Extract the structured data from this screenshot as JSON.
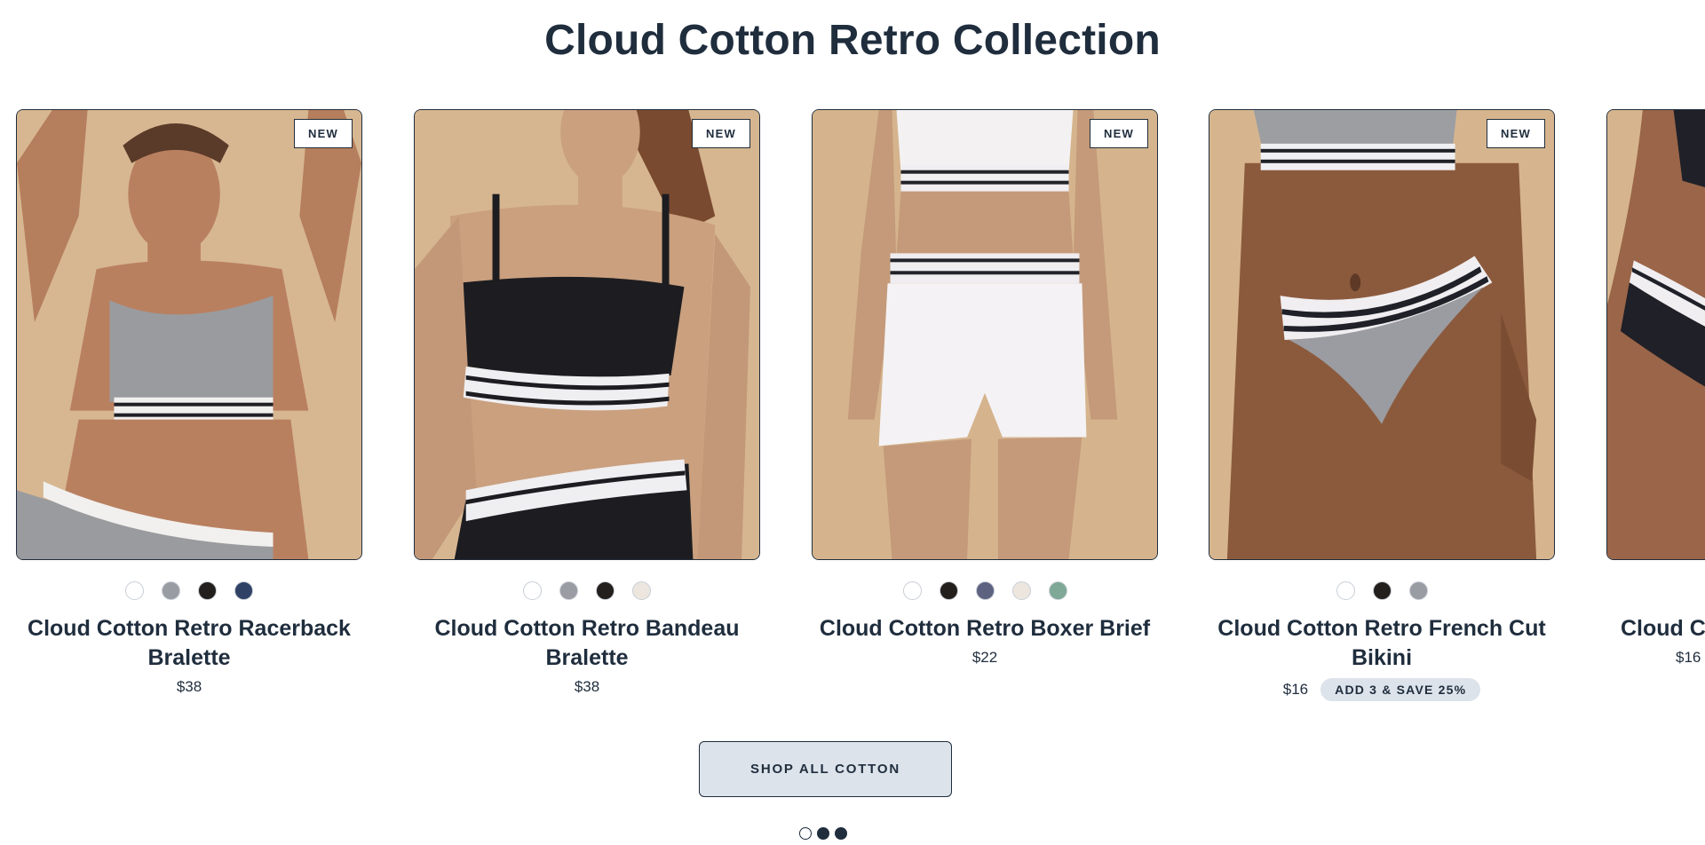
{
  "section": {
    "title": "Cloud Cotton Retro Collection"
  },
  "products": [
    {
      "badge": "NEW",
      "name": "Cloud Cotton Retro Racerback Bralette",
      "price": "$38",
      "swatches": [
        "#ffffff",
        "#9a9ca3",
        "#231f1c",
        "#2f4266"
      ]
    },
    {
      "badge": "NEW",
      "name": "Cloud Cotton Retro Bandeau Bralette",
      "price": "$38",
      "swatches": [
        "#ffffff",
        "#9a9ca3",
        "#231f1c",
        "#ece6df"
      ]
    },
    {
      "badge": "NEW",
      "name": "Cloud Cotton Retro Boxer Brief",
      "price": "$22",
      "swatches": [
        "#ffffff",
        "#231f1c",
        "#5d6280",
        "#ece6df",
        "#7fa896"
      ]
    },
    {
      "badge": "NEW",
      "name": "Cloud Cotton Retro French Cut Bikini",
      "price": "$16",
      "promo": "ADD 3 & SAVE 25%",
      "swatches": [
        "#ffffff",
        "#231f1c",
        "#9a9ca3"
      ]
    },
    {
      "name": "Cloud Cotton Retro Brief",
      "price": "$16"
    }
  ],
  "cta": {
    "label": "SHOP ALL COTTON"
  },
  "pagination": {
    "total": 3,
    "current": 1
  },
  "colors": {
    "text": "#1f2d3d",
    "photo_background": "#d4b48e",
    "button_background": "#dce3ea"
  }
}
